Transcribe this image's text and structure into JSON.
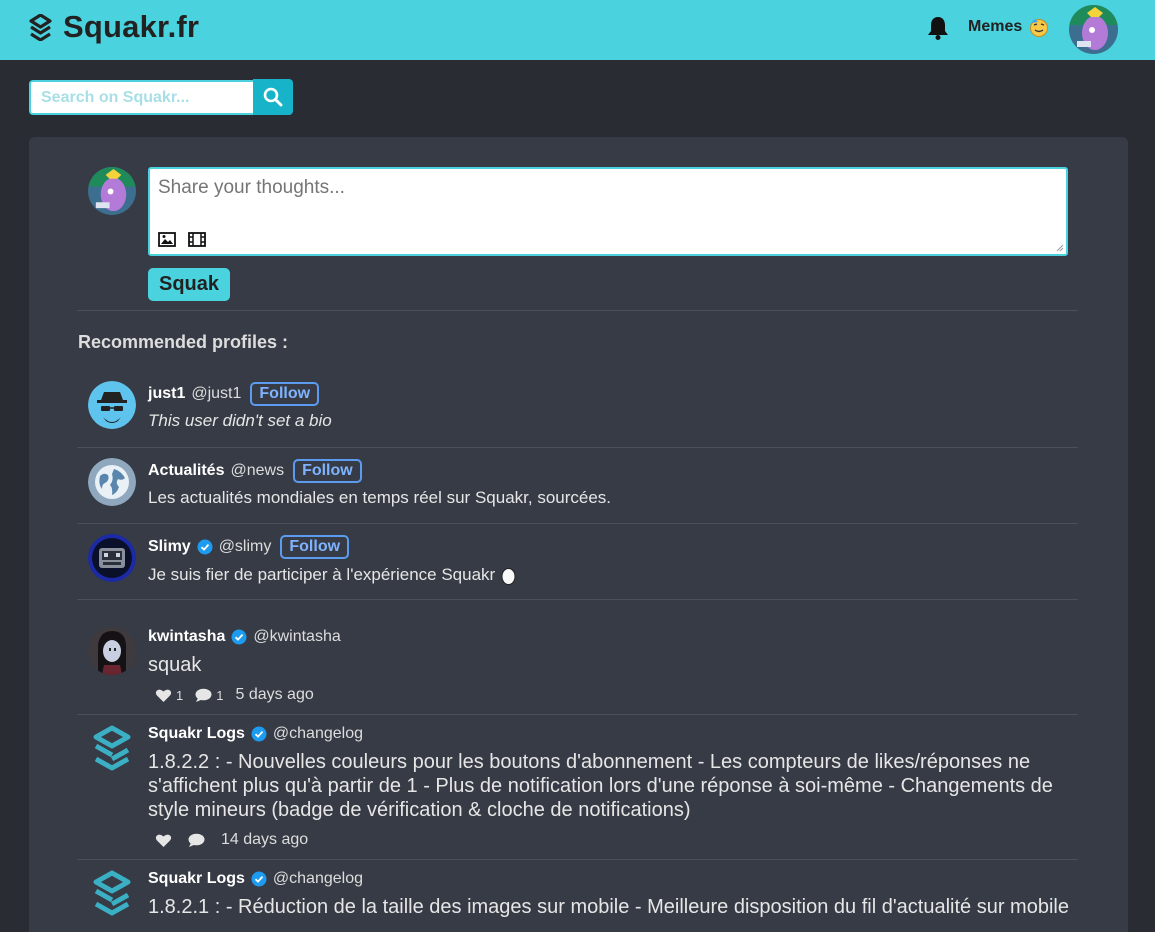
{
  "header": {
    "logo_text": "Squakr.fr",
    "memes_label": "Memes",
    "accent": "#4ad3de"
  },
  "search": {
    "placeholder": "Search on Squakr..."
  },
  "compose": {
    "placeholder": "Share your thoughts...",
    "submit_label": "Squak"
  },
  "recommended": {
    "title": "Recommended profiles :",
    "follow_label": "Follow",
    "profiles": [
      {
        "name": "just1",
        "handle": "@just1",
        "verified": false,
        "bio": "This user didn't set a bio",
        "avatar_icon": "incognito-icon"
      },
      {
        "name": "Actualités",
        "handle": "@news",
        "verified": false,
        "bio": "Les actualités mondiales en temps réel sur Squakr, sourcées.",
        "avatar_icon": "globe-icon"
      },
      {
        "name": "Slimy",
        "handle": "@slimy",
        "verified": true,
        "bio": "Je suis fier de participer à l'expérience Squakr",
        "avatar_icon": "robot-icon"
      }
    ]
  },
  "posts": [
    {
      "name": "kwintasha",
      "handle": "@kwintasha",
      "verified": true,
      "text": "squak",
      "likes": "1",
      "replies": "1",
      "time": "5 days ago"
    },
    {
      "name": "Squakr Logs",
      "handle": "@changelog",
      "verified": true,
      "text": "1.8.2.2 : - Nouvelles couleurs pour les boutons d'abonnement - Les compteurs de likes/réponses ne s'affichent plus qu'à partir de 1 - Plus de notification lors d'une réponse à soi-même - Changements de style mineurs (badge de vérification & cloche de notifications)",
      "likes": "",
      "replies": "",
      "time": "14 days ago"
    },
    {
      "name": "Squakr Logs",
      "handle": "@changelog",
      "verified": true,
      "text": "1.8.2.1 : - Réduction de la taille des images sur mobile - Meilleure disposition du fil d'actualité sur mobile",
      "likes": "",
      "replies": "",
      "time": ""
    }
  ]
}
